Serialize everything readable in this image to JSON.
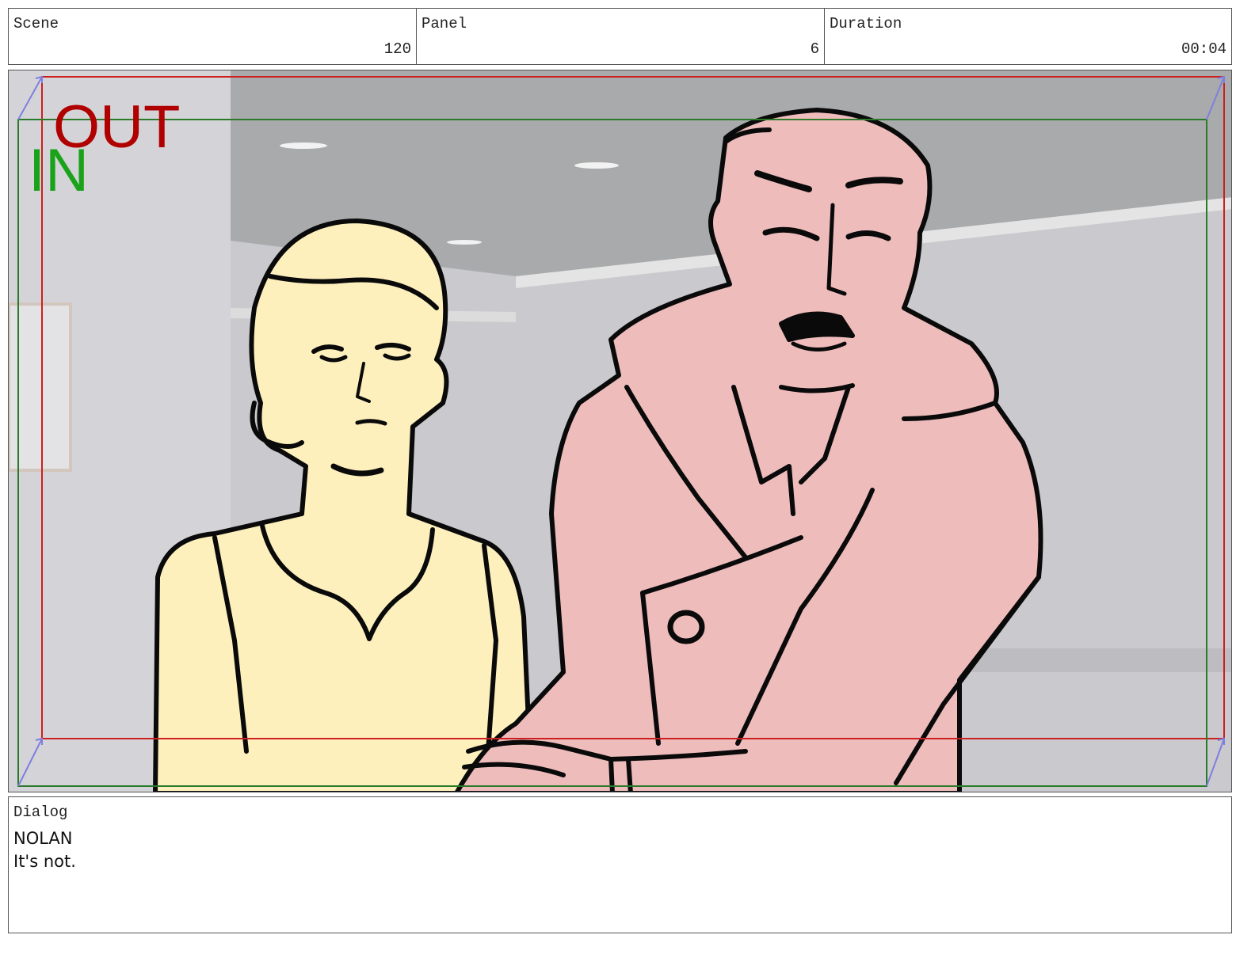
{
  "header": {
    "scene": {
      "label": "Scene",
      "value": "120"
    },
    "panel": {
      "label": "Panel",
      "value": "6"
    },
    "duration": {
      "label": "Duration",
      "value": "00:04"
    }
  },
  "frame": {
    "in_label": "IN",
    "out_label": "OUT",
    "colors": {
      "in": "#1aa31a",
      "out": "#b00000",
      "safe_in_frame": "#2a7a2a",
      "safe_out_frame": "#cc1f1f",
      "background_wall": "#c9c9cd",
      "woman_fill": "#fdf0bd",
      "man_fill": "#efbcbc",
      "line_art": "#0a0a0a"
    }
  },
  "dialog": {
    "label": "Dialog",
    "character": "NOLAN",
    "line": "It's not."
  }
}
